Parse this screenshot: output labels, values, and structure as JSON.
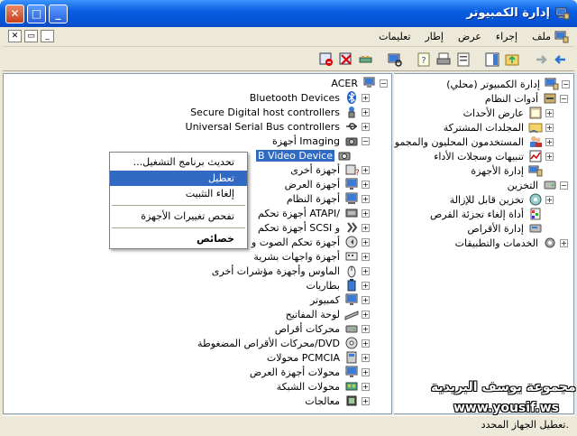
{
  "window": {
    "title": "إدارة الكمبيوتر"
  },
  "menu": [
    "ملف",
    "إجراء",
    "عرض",
    "إطار",
    "تعليمات"
  ],
  "mdi_controls": [
    "_",
    "▭",
    "✕"
  ],
  "caption_buttons": {
    "minimize": "_",
    "maximize": "□",
    "close": "✕"
  },
  "tree": {
    "root": "إدارة الكمبيوتر (محلي)",
    "items": [
      {
        "label": "أدوات النظام"
      },
      {
        "label": "عارض الأحداث"
      },
      {
        "label": "المجلدات المشتركة"
      },
      {
        "label": "المستخدمون المحليون والمجموعات"
      },
      {
        "label": "تنبيهات وسجلات الأداء"
      },
      {
        "label": "إدارة الأجهزة"
      },
      {
        "label": "التخزين"
      },
      {
        "label": "تخزين قابل للإزالة"
      },
      {
        "label": "أداة إلغاء تجزئة القرص"
      },
      {
        "label": "إدارة الأقراص"
      },
      {
        "label": "الخدمات والتطبيقات"
      }
    ]
  },
  "devices": {
    "root": "ACER",
    "items": [
      {
        "label": "Bluetooth Devices"
      },
      {
        "label": "Secure Digital host controllers"
      },
      {
        "label": "Universal Serial Bus controllers"
      },
      {
        "label": "أجهزة Imaging"
      },
      {
        "label": "B Video Device"
      },
      {
        "label": "أجهزة أخرى"
      },
      {
        "label": "أجهزة العرض"
      },
      {
        "label": "أجهزة النظام"
      },
      {
        "label": "أجهزة تحكم ATAPI/"
      },
      {
        "label": "أجهزة تحكم SCSI و"
      },
      {
        "label": "أجهزة تحكم الصوت و"
      },
      {
        "label": "أجهزة واجهات بشرية"
      },
      {
        "label": "الماوس وأجهزة مؤشرات أخرى"
      },
      {
        "label": "بطاريات"
      },
      {
        "label": "كمبيوتر"
      },
      {
        "label": "لوحة المفاتيح"
      },
      {
        "label": "محركات أقراص"
      },
      {
        "label": "محركات الأقراص المضغوطة/DVD"
      },
      {
        "label": "محولات PCMCIA"
      },
      {
        "label": "محولات أجهزة العرض"
      },
      {
        "label": "محولات الشبكة"
      },
      {
        "label": "معالجات"
      }
    ]
  },
  "context_menu": {
    "update": "تحديث برنامج التشغيل...",
    "disable": "تعطيل",
    "uninstall": "إلغاء التثبيت",
    "scan": "تفحص تغييرات الأجهزة",
    "properties": "خصائص"
  },
  "status": "تعطيل الجهاز المحدد.",
  "watermark": {
    "arabic": "مجموعة يوسف البريدية",
    "url": "www.yousif.ws"
  },
  "colors": {
    "titlebar": "#0653d6",
    "selection": "#316ac5"
  }
}
